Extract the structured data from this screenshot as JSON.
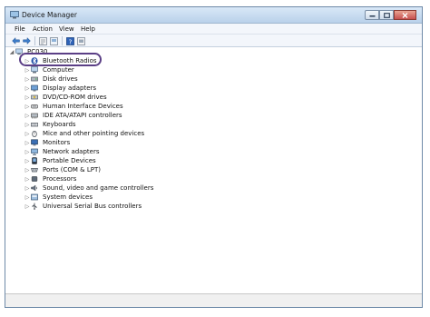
{
  "window": {
    "title": "Device Manager"
  },
  "menu": {
    "file": "File",
    "action": "Action",
    "view": "View",
    "help": "Help"
  },
  "toolbar": [
    "back-arrow-icon",
    "forward-arrow-icon",
    "properties-icon",
    "show-hide-icon",
    "help-icon",
    "scan-icon"
  ],
  "tree": {
    "root": "PC030",
    "items": [
      {
        "label": "Bluetooth Radios",
        "icon": "bluetooth-icon"
      },
      {
        "label": "Computer",
        "icon": "computer-icon"
      },
      {
        "label": "Disk drives",
        "icon": "disk-drive-icon"
      },
      {
        "label": "Display adapters",
        "icon": "display-adapter-icon"
      },
      {
        "label": "DVD/CD-ROM drives",
        "icon": "dvd-drive-icon"
      },
      {
        "label": "Human Interface Devices",
        "icon": "hid-icon"
      },
      {
        "label": "IDE ATA/ATAPI controllers",
        "icon": "ide-controller-icon"
      },
      {
        "label": "Keyboards",
        "icon": "keyboard-icon"
      },
      {
        "label": "Mice and other pointing devices",
        "icon": "mouse-icon"
      },
      {
        "label": "Monitors",
        "icon": "monitor-icon"
      },
      {
        "label": "Network adapters",
        "icon": "network-adapter-icon"
      },
      {
        "label": "Portable Devices",
        "icon": "portable-device-icon"
      },
      {
        "label": "Ports (COM & LPT)",
        "icon": "port-icon"
      },
      {
        "label": "Processors",
        "icon": "processor-icon"
      },
      {
        "label": "Sound, video and game controllers",
        "icon": "sound-icon"
      },
      {
        "label": "System devices",
        "icon": "system-device-icon"
      },
      {
        "label": "Universal Serial Bus controllers",
        "icon": "usb-icon"
      }
    ]
  },
  "colors": {
    "highlight_ring": "#5b3f86",
    "titlebar": "#c6daf0",
    "close_button": "#c75050"
  }
}
